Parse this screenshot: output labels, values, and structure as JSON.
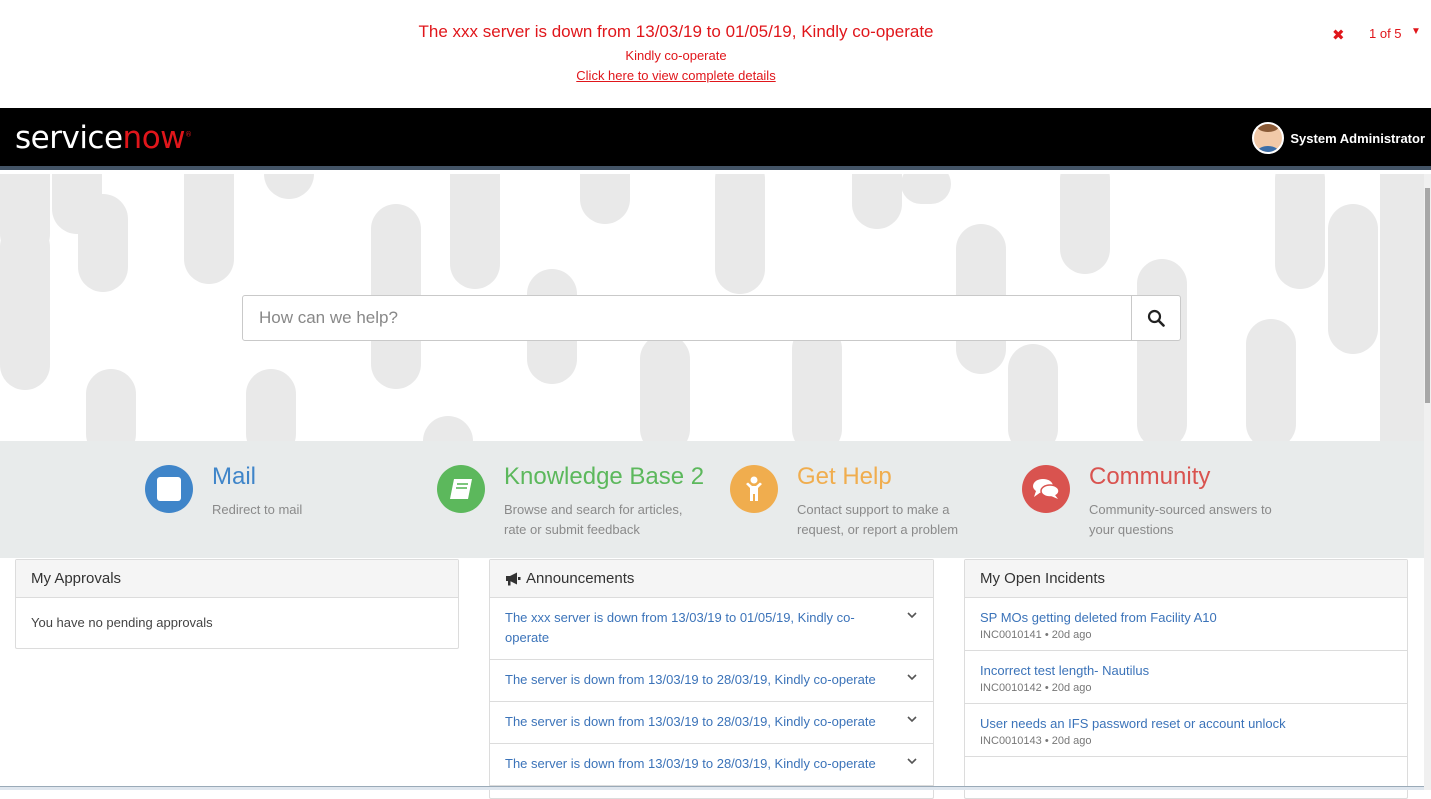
{
  "banner": {
    "title": "The xxx server is down from 13/03/19 to 01/05/19, Kindly co-operate",
    "subtitle": "Kindly co-operate",
    "link": "Click here to view complete details",
    "pager": "1 of 5",
    "close_icon": "close-icon",
    "accent": "#e0161b"
  },
  "header": {
    "logo_service": "service",
    "logo_now": "now",
    "user_name": "System Administrator"
  },
  "search": {
    "placeholder": "How can we help?"
  },
  "quick_links": [
    {
      "name": "Mail",
      "description": "Redirect to mail",
      "color": "#3f85c9",
      "icon": "mail-icon"
    },
    {
      "name": "Knowledge Base 2",
      "description": "Browse and search for articles, rate or submit feedback",
      "color": "#5cb85c",
      "icon": "book-icon"
    },
    {
      "name": "Get Help",
      "description": "Contact support to make a request, or report a problem",
      "color": "#f0ad4e",
      "icon": "person-icon"
    },
    {
      "name": "Community",
      "description": "Community-sourced answers to your questions",
      "color": "#d9534f",
      "icon": "comments-icon"
    }
  ],
  "approvals": {
    "title": "My Approvals",
    "empty_text": "You have no pending approvals"
  },
  "announcements": {
    "title": "Announcements",
    "items": [
      "The xxx server is down from 13/03/19 to 01/05/19, Kindly co-operate",
      "The server is down from 13/03/19 to 28/03/19, Kindly co-operate",
      "The server is down from 13/03/19 to 28/03/19, Kindly co-operate",
      "The server is down from 13/03/19 to 28/03/19, Kindly co-operate"
    ]
  },
  "incidents": {
    "title": "My Open Incidents",
    "items": [
      {
        "title": "SP MOs getting deleted from Facility A10",
        "meta": "INC0010141 • 20d ago"
      },
      {
        "title": "Incorrect test length- Nautilus",
        "meta": "INC0010142 • 20d ago"
      },
      {
        "title": "User needs an IFS password reset or account unlock",
        "meta": "INC0010143 • 20d ago"
      }
    ]
  }
}
